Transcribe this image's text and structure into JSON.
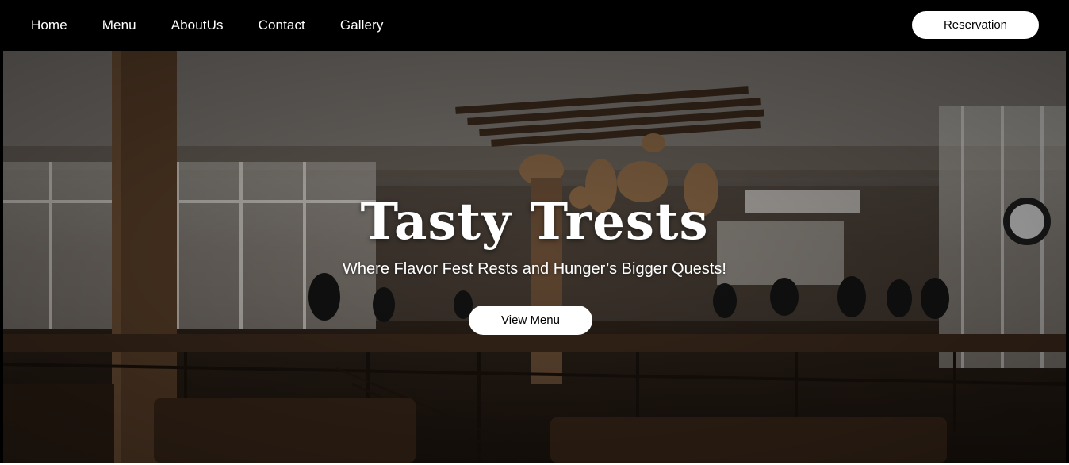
{
  "nav": {
    "links": [
      "Home",
      "Menu",
      "AboutUs",
      "Contact",
      "Gallery"
    ],
    "reservation_label": "Reservation"
  },
  "hero": {
    "title": "Tasty Trests",
    "tagline": "Where Flavor Fest Rests and Hunger’s Bigger Quests!",
    "cta_label": "View Menu",
    "background": "restaurant interior photo"
  },
  "colors": {
    "navbar_bg": "#000000",
    "button_bg": "#ffffff",
    "text": "#ffffff"
  }
}
